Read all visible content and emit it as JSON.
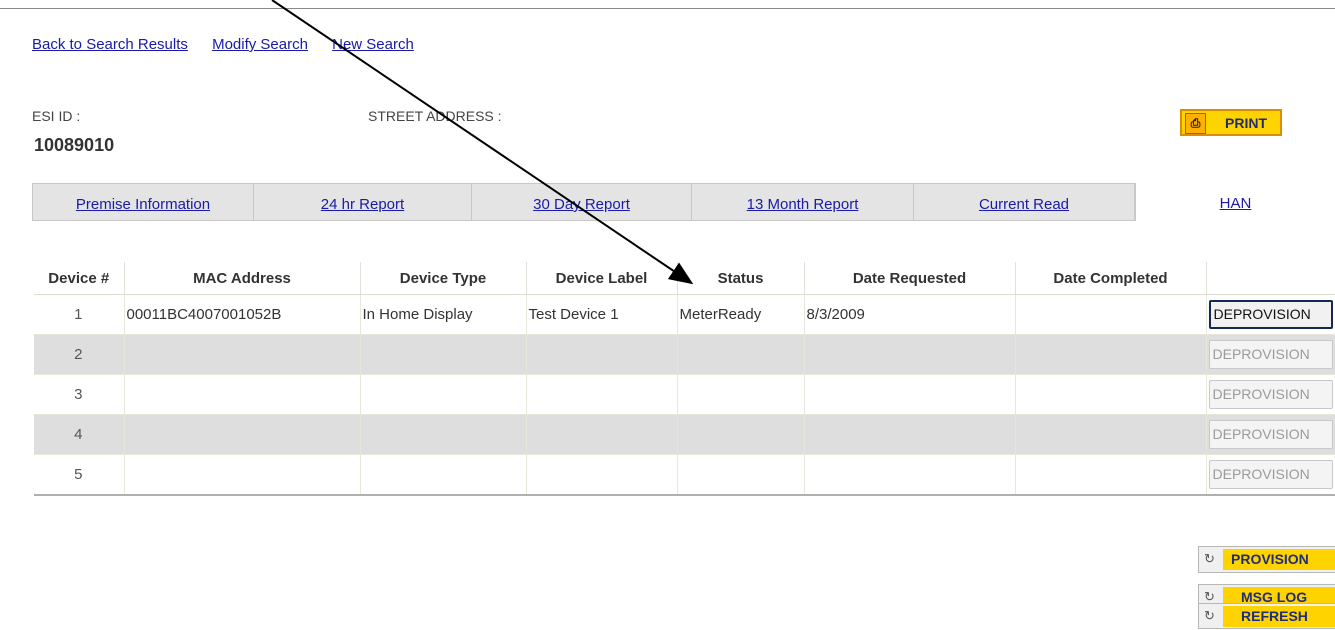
{
  "nav": {
    "back": "Back to Search Results",
    "modify": "Modify Search",
    "new": "New Search"
  },
  "premise": {
    "esi_label": "ESI ID :",
    "esi_value": "10089010",
    "address_label": "STREET ADDRESS :"
  },
  "print_label": "PRINT",
  "tabs": [
    {
      "label": "Premise Information",
      "active": false
    },
    {
      "label": "24 hr Report",
      "active": false
    },
    {
      "label": "30 Day Report",
      "active": false
    },
    {
      "label": "13 Month Report",
      "active": false
    },
    {
      "label": "Current Read",
      "active": false
    },
    {
      "label": "HAN",
      "active": true
    }
  ],
  "table": {
    "headers": [
      "Device #",
      "MAC Address",
      "Device Type",
      "Device Label",
      "Status",
      "Date Requested",
      "Date Completed",
      ""
    ],
    "rows": [
      {
        "num": "1",
        "mac": "00011BC4007001052B",
        "type": "In Home Display",
        "label": "Test Device 1",
        "status": "MeterReady",
        "requested": "8/3/2009",
        "completed": "",
        "button": "DEPROVISION",
        "enabled": true
      },
      {
        "num": "2",
        "mac": "",
        "type": "",
        "label": "",
        "status": "",
        "requested": "",
        "completed": "",
        "button": "DEPROVISION",
        "enabled": false
      },
      {
        "num": "3",
        "mac": "",
        "type": "",
        "label": "",
        "status": "",
        "requested": "",
        "completed": "",
        "button": "DEPROVISION",
        "enabled": false
      },
      {
        "num": "4",
        "mac": "",
        "type": "",
        "label": "",
        "status": "",
        "requested": "",
        "completed": "",
        "button": "DEPROVISION",
        "enabled": false
      },
      {
        "num": "5",
        "mac": "",
        "type": "",
        "label": "",
        "status": "",
        "requested": "",
        "completed": "",
        "button": "DEPROVISION",
        "enabled": false
      }
    ]
  },
  "actions": {
    "provision": "PROVISION",
    "msg_log": "MSG LOG",
    "refresh": "REFRESH"
  },
  "colors": {
    "accent_yellow": "#ffd300",
    "link_blue": "#1a1aa8",
    "alt_row": "#dedede"
  }
}
